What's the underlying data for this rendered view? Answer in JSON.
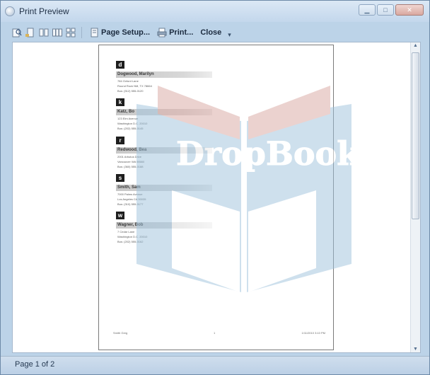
{
  "window": {
    "title": "Print Preview",
    "controls": [
      "minimize-icon",
      "maximize-icon",
      "close-icon"
    ]
  },
  "toolbar": {
    "view_icons": [
      "zoom-icon",
      "one-page-icon",
      "two-page-icon",
      "three-page-icon",
      "six-page-icon"
    ],
    "page_setup_label": "Page Setup...",
    "print_label": "Print...",
    "close_label": "Close"
  },
  "page": {
    "entries": [
      {
        "letter": "d",
        "name": "Dogwood, Marilyn",
        "lines": [
          "784 Oxford Lane",
          "Round Rock NM, TX 78664",
          "Bus:  (512) 555-0120"
        ]
      },
      {
        "letter": "k",
        "name": "Katz, Bo",
        "lines": [
          "123 Elm Avenue",
          "Washington D.C. 20010",
          "Bus:  (202) 555-0145"
        ]
      },
      {
        "letter": "r",
        "name": "Redwood, Bea",
        "lines": [
          "2001 Arbutus Drive",
          "Vancouver WA 98660",
          "Bus:  (360) 555-0188"
        ]
      },
      {
        "letter": "s",
        "name": "Smith, Sam",
        "lines": [
          "7000 Palms Avenue",
          "Los Angeles CA 90035",
          "Bus:  (310) 555-0177"
        ]
      },
      {
        "letter": "w",
        "name": "Wagner, Bob",
        "lines": [
          "7 Cedar Lane",
          "Washington D.C. 20010",
          "Bus:  (202) 555-0162"
        ]
      }
    ],
    "footer": {
      "left": "Smith Greg",
      "center": "1",
      "right": "1/11/2010 3:10 PM"
    }
  },
  "watermark": {
    "text": "DropBooks",
    "color": "#c9302c"
  },
  "status": {
    "text": "Page 1 of 2"
  },
  "colors": {
    "frame": "#bcd3e8",
    "accent": "#2b4a6f"
  }
}
